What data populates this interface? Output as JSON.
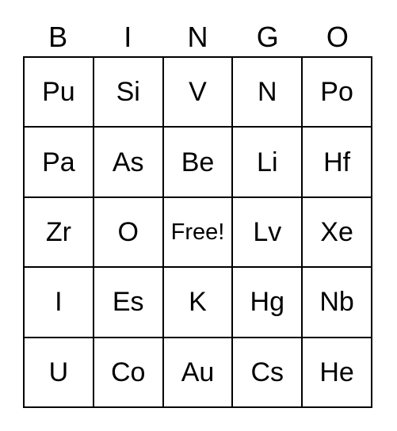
{
  "card": {
    "title": "BINGO",
    "header": {
      "letters": [
        "B",
        "I",
        "N",
        "G",
        "O"
      ]
    },
    "colors": {
      "background": "#ffffff",
      "grid_line": "#000000",
      "text": "#000000"
    },
    "free_space_label": "Free!",
    "free_space_position": {
      "row": 3,
      "column": 3
    },
    "grid": {
      "rows": 5,
      "columns": 5,
      "cells": [
        [
          {
            "label": "Pu"
          },
          {
            "label": "Si"
          },
          {
            "label": "V"
          },
          {
            "label": "N"
          },
          {
            "label": "Po"
          }
        ],
        [
          {
            "label": "Pa"
          },
          {
            "label": "As"
          },
          {
            "label": "Be"
          },
          {
            "label": "Li"
          },
          {
            "label": "Hf"
          }
        ],
        [
          {
            "label": "Zr"
          },
          {
            "label": "O"
          },
          {
            "label": "Free!"
          },
          {
            "label": "Lv"
          },
          {
            "label": "Xe"
          }
        ],
        [
          {
            "label": "I"
          },
          {
            "label": "Es"
          },
          {
            "label": "K"
          },
          {
            "label": "Hg"
          },
          {
            "label": "Nb"
          }
        ],
        [
          {
            "label": "U"
          },
          {
            "label": "Co"
          },
          {
            "label": "Au"
          },
          {
            "label": "Cs"
          },
          {
            "label": "He"
          }
        ]
      ]
    }
  }
}
